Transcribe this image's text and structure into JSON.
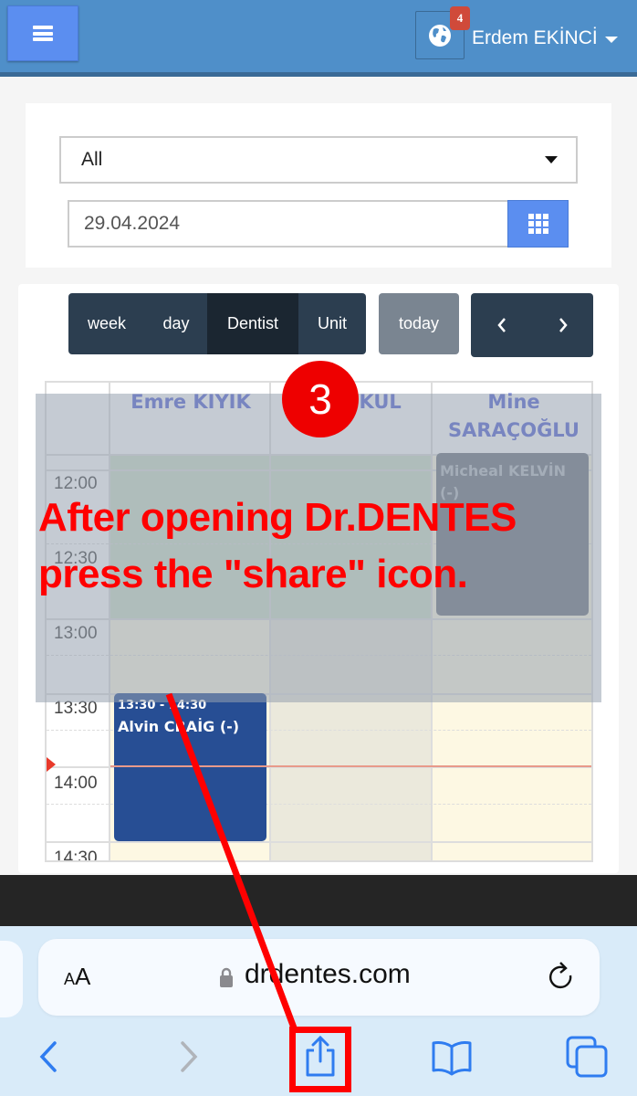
{
  "navbar": {
    "menu_icon": "hamburger-icon",
    "globe_icon": "globe-icon",
    "notification_count": "4",
    "user_name": "Erdem EKİNCİ"
  },
  "filters": {
    "select_value": "All",
    "date_value": "29.04.2024",
    "calendar_icon": "grid-calendar-icon"
  },
  "calendar": {
    "view_buttons": [
      {
        "label": "week",
        "active": false
      },
      {
        "label": "day",
        "active": false
      },
      {
        "label": "Dentist",
        "active": true
      },
      {
        "label": "Unit",
        "active": false
      }
    ],
    "today_label": "today",
    "prev_icon": "chevron-left-icon",
    "next_icon": "chevron-right-icon",
    "columns": [
      {
        "name": "Emre KIYIK"
      },
      {
        "name": "n KUL"
      },
      {
        "name": "Mine SARAÇOĞLU"
      }
    ],
    "time_slots": [
      "12:00",
      "12:30",
      "13:00",
      "13:30",
      "14:00",
      "14:30"
    ],
    "events": [
      {
        "column": 3,
        "time": "",
        "patient": "Micheal KELVİN (-)",
        "color": "#6f7680"
      },
      {
        "column": 1,
        "time": "13:30 - 14:30",
        "patient": "Alvin CRAİG (-)",
        "color": "#274e94"
      }
    ]
  },
  "annotation": {
    "step_number": "3",
    "instruction_line1": "After opening Dr.DENTES",
    "instruction_line2": "press the \"share\" icon.",
    "color": "#ff0000"
  },
  "browser": {
    "text_size_label_small": "A",
    "text_size_label_big": "A",
    "url": "drdentes.com",
    "lock_icon": "lock-icon",
    "reload_icon": "reload-icon",
    "toolbar": [
      "back-icon",
      "forward-icon",
      "share-icon",
      "bookmarks-icon",
      "tabs-icon"
    ],
    "accent": "#2f7cf0"
  }
}
